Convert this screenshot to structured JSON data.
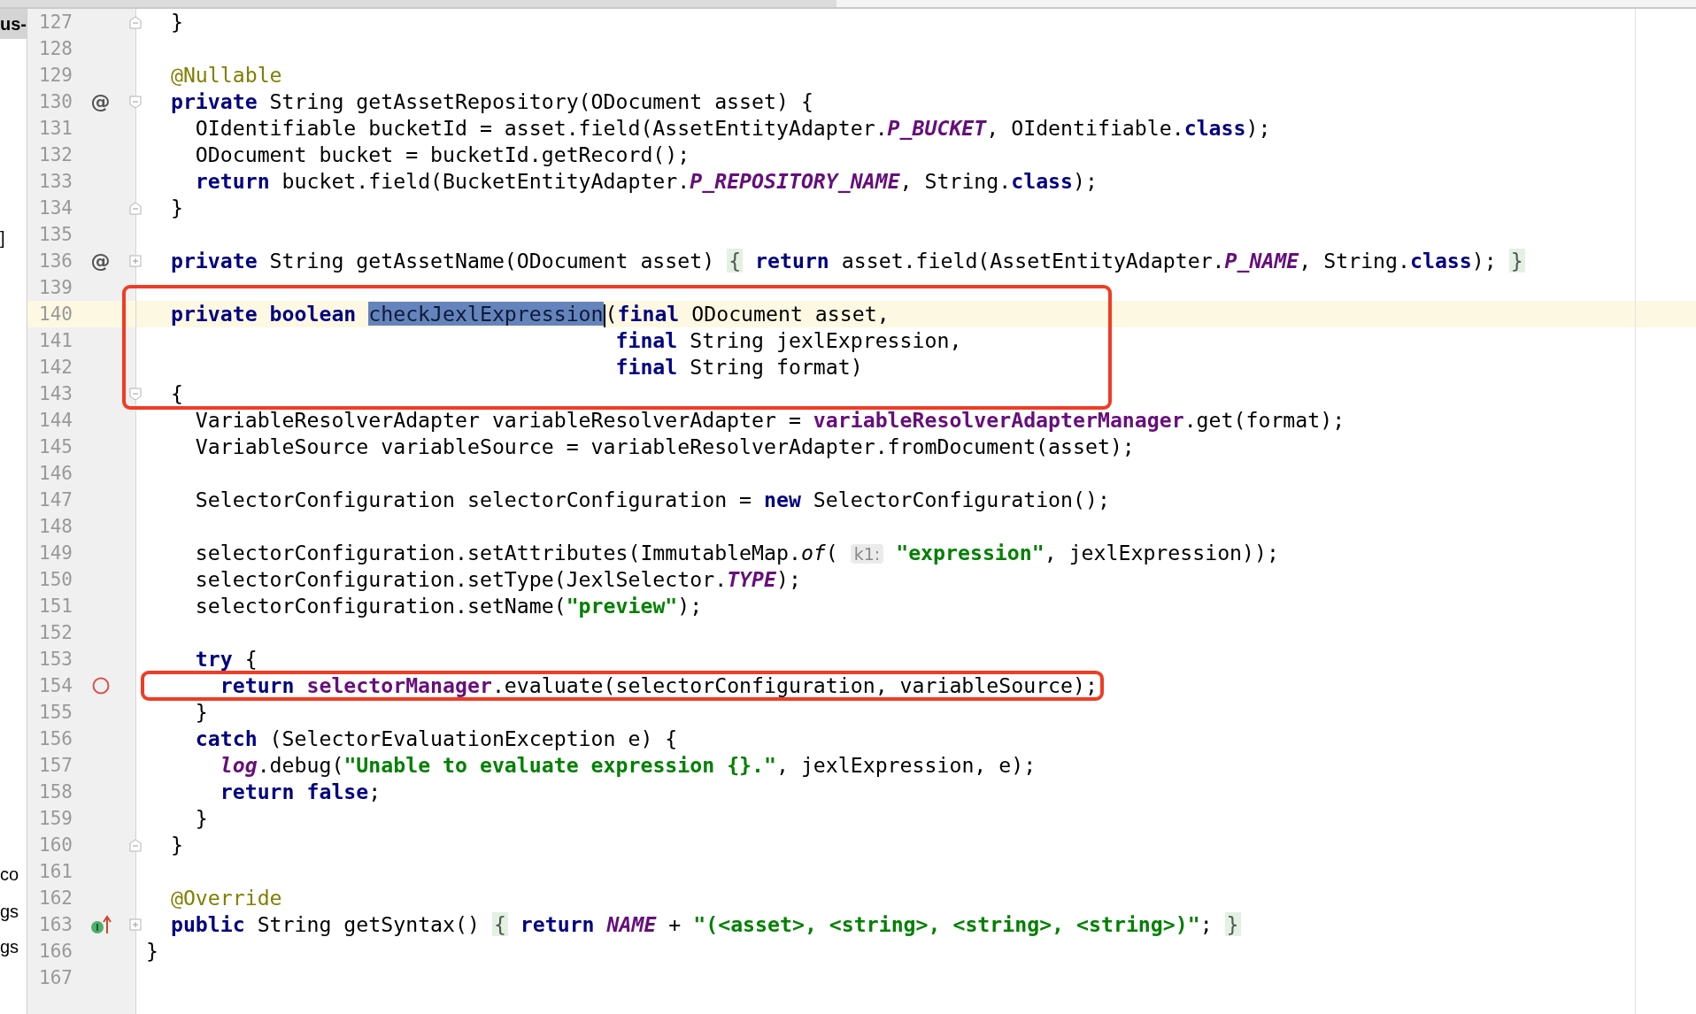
{
  "project_panel": {
    "items": [
      {
        "text": "us-",
        "selected": true
      },
      {
        "text": "]",
        "selected": false
      },
      {
        "text": "co",
        "selected": false
      },
      {
        "text": "gs",
        "selected": false
      },
      {
        "text": "gs",
        "selected": false
      }
    ]
  },
  "editor": {
    "lines": [
      {
        "number": "127",
        "fold": {
          "kind": "end"
        },
        "tokens": [
          {
            "kind": "plain",
            "text": "  }"
          }
        ]
      },
      {
        "number": "128"
      },
      {
        "number": "129",
        "tokens": [
          {
            "kind": "annot",
            "text": "  @Nullable"
          }
        ]
      },
      {
        "number": "130",
        "marker": {
          "kind": "override",
          "glyph": "@"
        },
        "fold": {
          "kind": "start"
        },
        "tokens": [
          {
            "kind": "kw",
            "text": "  private"
          },
          {
            "kind": "plain",
            "text": " String getAssetRepository(ODocument asset) {"
          }
        ]
      },
      {
        "number": "131",
        "tokens": [
          {
            "kind": "plain",
            "text": "    OIdentifiable bucketId = asset.field(AssetEntityAdapter."
          },
          {
            "kind": "static",
            "text": "P_BUCKET"
          },
          {
            "kind": "plain",
            "text": ", OIdentifiable."
          },
          {
            "kind": "kw",
            "text": "class"
          },
          {
            "kind": "plain",
            "text": ");"
          }
        ]
      },
      {
        "number": "132",
        "tokens": [
          {
            "kind": "plain",
            "text": "    ODocument bucket = bucketId.getRecord();"
          }
        ]
      },
      {
        "number": "133",
        "tokens": [
          {
            "kind": "kw",
            "text": "    return"
          },
          {
            "kind": "plain",
            "text": " bucket.field(BucketEntityAdapter."
          },
          {
            "kind": "static",
            "text": "P_REPOSITORY_NAME"
          },
          {
            "kind": "plain",
            "text": ", String."
          },
          {
            "kind": "kw",
            "text": "class"
          },
          {
            "kind": "plain",
            "text": ");"
          }
        ]
      },
      {
        "number": "134",
        "fold": {
          "kind": "end"
        },
        "tokens": [
          {
            "kind": "plain",
            "text": "  }"
          }
        ]
      },
      {
        "number": "135"
      },
      {
        "number": "136",
        "marker": {
          "kind": "override",
          "glyph": "@"
        },
        "fold": {
          "kind": "collapsed"
        },
        "tokens": [
          {
            "kind": "kw",
            "text": "  private"
          },
          {
            "kind": "plain",
            "text": " String getAssetName(ODocument asset) "
          },
          {
            "kind": "folded",
            "text": "{"
          },
          {
            "kind": "kw",
            "text": " return"
          },
          {
            "kind": "plain",
            "text": " asset.field(AssetEntityAdapter."
          },
          {
            "kind": "static",
            "text": "P_NAME"
          },
          {
            "kind": "plain",
            "text": ", String."
          },
          {
            "kind": "kw",
            "text": "class"
          },
          {
            "kind": "plain",
            "text": "); "
          },
          {
            "kind": "folded",
            "text": "}"
          }
        ]
      },
      {
        "number": "139"
      },
      {
        "number": "140",
        "current": true,
        "callout_start": true,
        "tokens": [
          {
            "kind": "kw",
            "text": "  private boolean "
          },
          {
            "kind": "selected",
            "text": "checkJexlExpression",
            "caret": true
          },
          {
            "kind": "plain",
            "text": "("
          },
          {
            "kind": "kw",
            "text": "final"
          },
          {
            "kind": "plain",
            "text": " ODocument asset,"
          }
        ]
      },
      {
        "number": "141",
        "tokens": [
          {
            "kind": "kw",
            "text": "                                      final"
          },
          {
            "kind": "plain",
            "text": " String jexlExpression,"
          }
        ]
      },
      {
        "number": "142",
        "tokens": [
          {
            "kind": "kw",
            "text": "                                      final"
          },
          {
            "kind": "plain",
            "text": " String format)"
          }
        ]
      },
      {
        "number": "143",
        "fold": {
          "kind": "start"
        },
        "callout_end": true,
        "tokens": [
          {
            "kind": "plain",
            "text": "  {"
          }
        ]
      },
      {
        "number": "144",
        "tokens": [
          {
            "kind": "plain",
            "text": "    VariableResolverAdapter variableResolverAdapter = "
          },
          {
            "kind": "field",
            "text": "variableResolverAdapterManager"
          },
          {
            "kind": "plain",
            "text": ".get(format);"
          }
        ]
      },
      {
        "number": "145",
        "tokens": [
          {
            "kind": "plain",
            "text": "    VariableSource variableSource = variableResolverAdapter.fromDocument(asset);"
          }
        ]
      },
      {
        "number": "146"
      },
      {
        "number": "147",
        "tokens": [
          {
            "kind": "plain",
            "text": "    SelectorConfiguration selectorConfiguration = "
          },
          {
            "kind": "kw",
            "text": "new"
          },
          {
            "kind": "plain",
            "text": " SelectorConfiguration();"
          }
        ]
      },
      {
        "number": "148"
      },
      {
        "number": "149",
        "tokens": [
          {
            "kind": "plain",
            "text": "    selectorConfiguration.setAttributes(ImmutableMap."
          },
          {
            "kind": "italic",
            "text": "of"
          },
          {
            "kind": "plain",
            "text": "( "
          },
          {
            "kind": "hint",
            "text": "k1:"
          },
          {
            "kind": "str",
            "text": " \"expression\""
          },
          {
            "kind": "plain",
            "text": ", jexlExpression));"
          }
        ]
      },
      {
        "number": "150",
        "tokens": [
          {
            "kind": "plain",
            "text": "    selectorConfiguration.setType(JexlSelector."
          },
          {
            "kind": "static",
            "text": "TYPE"
          },
          {
            "kind": "plain",
            "text": ");"
          }
        ]
      },
      {
        "number": "151",
        "tokens": [
          {
            "kind": "plain",
            "text": "    selectorConfiguration.setName("
          },
          {
            "kind": "str",
            "text": "\"preview\""
          },
          {
            "kind": "plain",
            "text": ");"
          }
        ]
      },
      {
        "number": "152"
      },
      {
        "number": "153",
        "tokens": [
          {
            "kind": "kw",
            "text": "    try"
          },
          {
            "kind": "plain",
            "text": " {"
          }
        ]
      },
      {
        "number": "154",
        "marker": {
          "kind": "breakpoint"
        },
        "callout_start": true,
        "callout_end": true,
        "tokens": [
          {
            "kind": "kw",
            "text": "      return "
          },
          {
            "kind": "field",
            "text": "selectorManager"
          },
          {
            "kind": "plain",
            "text": ".evaluate(selectorConfiguration, variableSource);"
          }
        ]
      },
      {
        "number": "155",
        "tokens": [
          {
            "kind": "plain",
            "text": "    }"
          }
        ]
      },
      {
        "number": "156",
        "tokens": [
          {
            "kind": "kw",
            "text": "    catch"
          },
          {
            "kind": "plain",
            "text": " (SelectorEvaluationException e) {"
          }
        ]
      },
      {
        "number": "157",
        "tokens": [
          {
            "kind": "static",
            "text": "      log"
          },
          {
            "kind": "plain",
            "text": ".debug("
          },
          {
            "kind": "str",
            "text": "\"Unable to evaluate expression {}.\""
          },
          {
            "kind": "plain",
            "text": ", jexlExpression, e);"
          }
        ]
      },
      {
        "number": "158",
        "tokens": [
          {
            "kind": "kw",
            "text": "      return false"
          },
          {
            "kind": "plain",
            "text": ";"
          }
        ]
      },
      {
        "number": "159",
        "tokens": [
          {
            "kind": "plain",
            "text": "    }"
          }
        ]
      },
      {
        "number": "160",
        "fold": {
          "kind": "end"
        },
        "tokens": [
          {
            "kind": "plain",
            "text": "  }"
          }
        ]
      },
      {
        "number": "161"
      },
      {
        "number": "162",
        "tokens": [
          {
            "kind": "annot",
            "text": "  @Override"
          }
        ]
      },
      {
        "number": "163",
        "marker": {
          "kind": "implements"
        },
        "fold": {
          "kind": "collapsed"
        },
        "tokens": [
          {
            "kind": "kw",
            "text": "  public"
          },
          {
            "kind": "plain",
            "text": " String getSyntax() "
          },
          {
            "kind": "folded",
            "text": "{"
          },
          {
            "kind": "kw",
            "text": " return "
          },
          {
            "kind": "static",
            "text": "NAME"
          },
          {
            "kind": "plain",
            "text": " + "
          },
          {
            "kind": "str",
            "text": "\"(<asset>, <string>, <string>, <string>)\""
          },
          {
            "kind": "plain",
            "text": "; "
          },
          {
            "kind": "folded",
            "text": "}"
          }
        ]
      },
      {
        "number": "166",
        "tokens": [
          {
            "kind": "plain",
            "text": "}"
          }
        ]
      },
      {
        "number": "167"
      }
    ]
  }
}
